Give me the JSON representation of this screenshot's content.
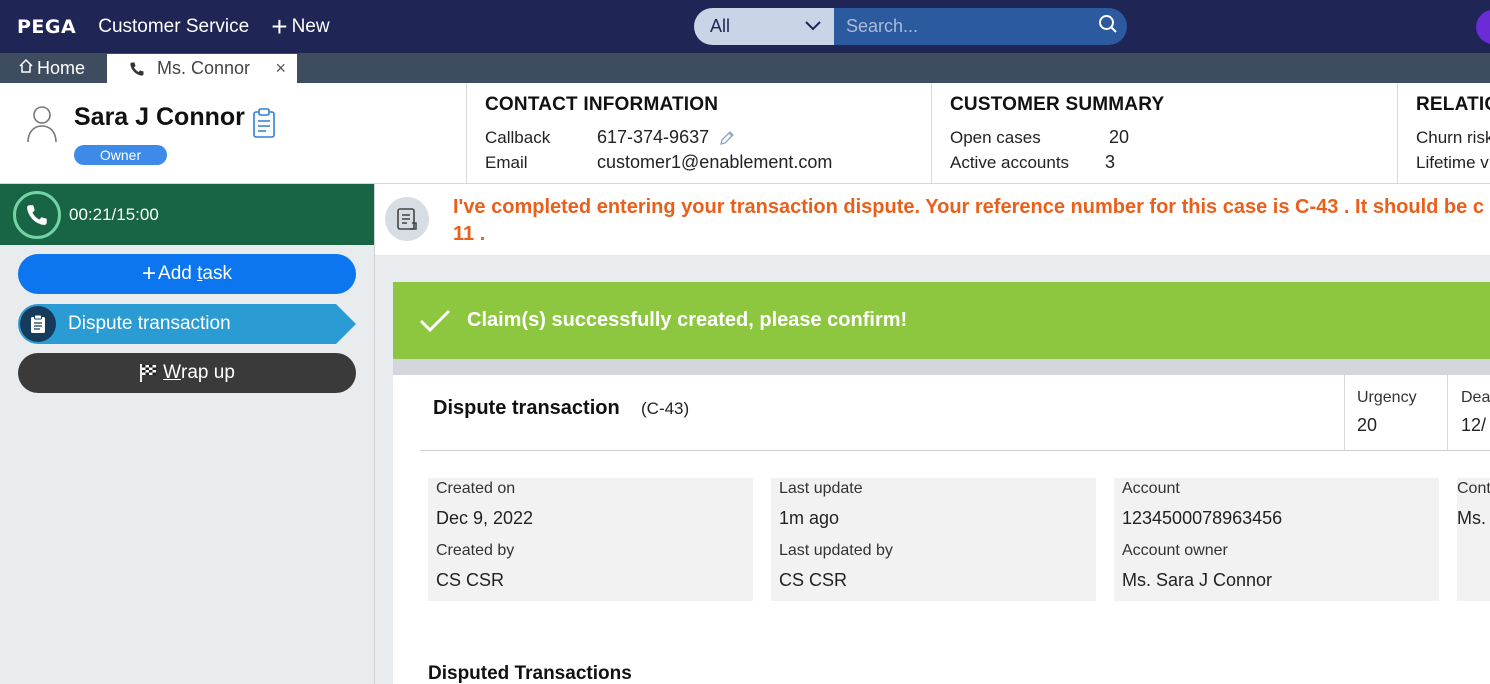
{
  "topbar": {
    "logo": "PEGA",
    "app_name": "Customer Service",
    "new_label": "New",
    "search_scope": "All",
    "search_placeholder": "Search..."
  },
  "tabs": {
    "home_label": "Home",
    "active_label": "Ms. Connor",
    "close_glyph": "×"
  },
  "customer": {
    "name": "Sara J Connor",
    "badge": "Owner"
  },
  "contact": {
    "title": "CONTACT INFORMATION",
    "callback_label": "Callback",
    "callback_value": "617-374-9637",
    "email_label": "Email",
    "email_value": "customer1@enablement.com"
  },
  "summary": {
    "title": "CUSTOMER SUMMARY",
    "open_cases_label": "Open cases",
    "open_cases_value": "20",
    "active_accounts_label": "Active accounts",
    "active_accounts_value": "3"
  },
  "relationship": {
    "title": "RELATIO",
    "churn_label": "Churn risk",
    "lifetime_label": "Lifetime v"
  },
  "call": {
    "timer": "00:21/15:00"
  },
  "sidebar": {
    "add_task_prefix": "Add ",
    "add_task_underlined": "t",
    "add_task_suffix": "ask",
    "dispute_label": "Dispute transaction",
    "wrap_underlined": "W",
    "wrap_suffix": "rap up"
  },
  "script": {
    "line1": "I've completed entering your transaction dispute. Your reference number for this case is C-43 . It should be c",
    "line2": "11 ."
  },
  "banner": {
    "message": "Claim(s) successfully created, please confirm!"
  },
  "case": {
    "title": "Dispute transaction",
    "id": "(C-43)",
    "urgency_label": "Urgency",
    "urgency_value": "20",
    "deadline_label": "Dea",
    "deadline_value": "12/"
  },
  "fields": {
    "created_on_label": "Created on",
    "created_on_value": "Dec 9, 2022",
    "created_by_label": "Created by",
    "created_by_value": "CS CSR",
    "last_update_label": "Last update",
    "last_update_value": "1m ago",
    "last_updated_by_label": "Last updated by",
    "last_updated_by_value": "CS CSR",
    "account_label": "Account",
    "account_value": "1234500078963456",
    "account_owner_label": "Account owner",
    "account_owner_value": "Ms. Sara J Connor",
    "contact_label": "Cont",
    "contact_value": "Ms."
  },
  "section": {
    "disputed_title": "Disputed Transactions"
  },
  "colors": {
    "topbar": "#1f2555",
    "tabbar": "#3d4d5f",
    "call_bar": "#176545",
    "primary_button": "#0b76f0",
    "task_active": "#2b9bd3",
    "success": "#8dc63f",
    "script_text": "#e8601c"
  }
}
